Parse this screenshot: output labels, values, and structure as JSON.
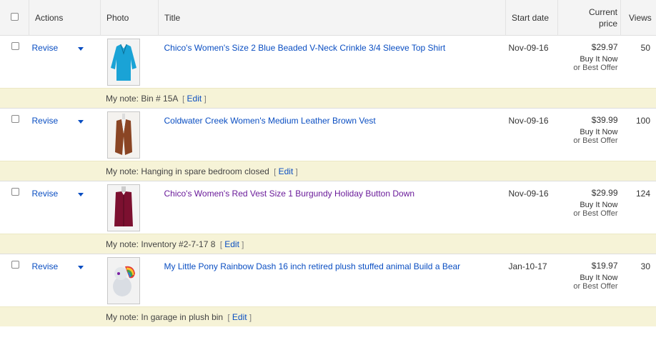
{
  "header": {
    "actions": "Actions",
    "photo": "Photo",
    "title": "Title",
    "start_date": "Start date",
    "current_price": "Current\nprice",
    "views": "Views"
  },
  "items": [
    {
      "action": "Revise",
      "title": "Chico's Women's Size 2 Blue Beaded V-Neck Crinkle 3/4 Sleeve Top Shirt",
      "start_date": "Nov-09-16",
      "price": "$29.97",
      "format": "Buy It Now",
      "best_offer": "or Best Offer",
      "views": "50",
      "note_label": "My note: Bin # 15A",
      "edit": "Edit",
      "photo_icon": "blue-shirt-photo",
      "title_color": "#0a4ec2"
    },
    {
      "action": "Revise",
      "title": "Coldwater Creek Women's Medium Leather Brown Vest",
      "start_date": "Nov-09-16",
      "price": "$39.99",
      "format": "Buy It Now",
      "best_offer": "or Best Offer",
      "views": "100",
      "note_label": "My note: Hanging in spare bedroom closed",
      "edit": "Edit",
      "photo_icon": "brown-vest-photo",
      "title_color": "#0a4ec2"
    },
    {
      "action": "Revise",
      "title": "Chico's Women's Red Vest Size 1 Burgundy Holiday Button Down",
      "start_date": "Nov-09-16",
      "price": "$29.99",
      "format": "Buy It Now",
      "best_offer": "or Best Offer",
      "views": "124",
      "note_label": "My note: Inventory #2-7-17 8",
      "edit": "Edit",
      "photo_icon": "burgundy-vest-photo",
      "title_color": "#6a1b9a"
    },
    {
      "action": "Revise",
      "title": "My Little Pony Rainbow Dash 16 inch retired plush stuffed animal Build a Bear",
      "start_date": "Jan-10-17",
      "price": "$19.97",
      "format": "Buy It Now",
      "best_offer": "or Best Offer",
      "views": "30",
      "note_label": "My note: In garage in plush bin",
      "edit": "Edit",
      "photo_icon": "rainbow-pony-photo",
      "title_color": "#0a4ec2"
    }
  ],
  "colors": {
    "link": "#0a4ec2",
    "visited_link": "#6a1b9a",
    "note_bg": "#f6f3d7",
    "header_bg": "#f4f4f4"
  }
}
